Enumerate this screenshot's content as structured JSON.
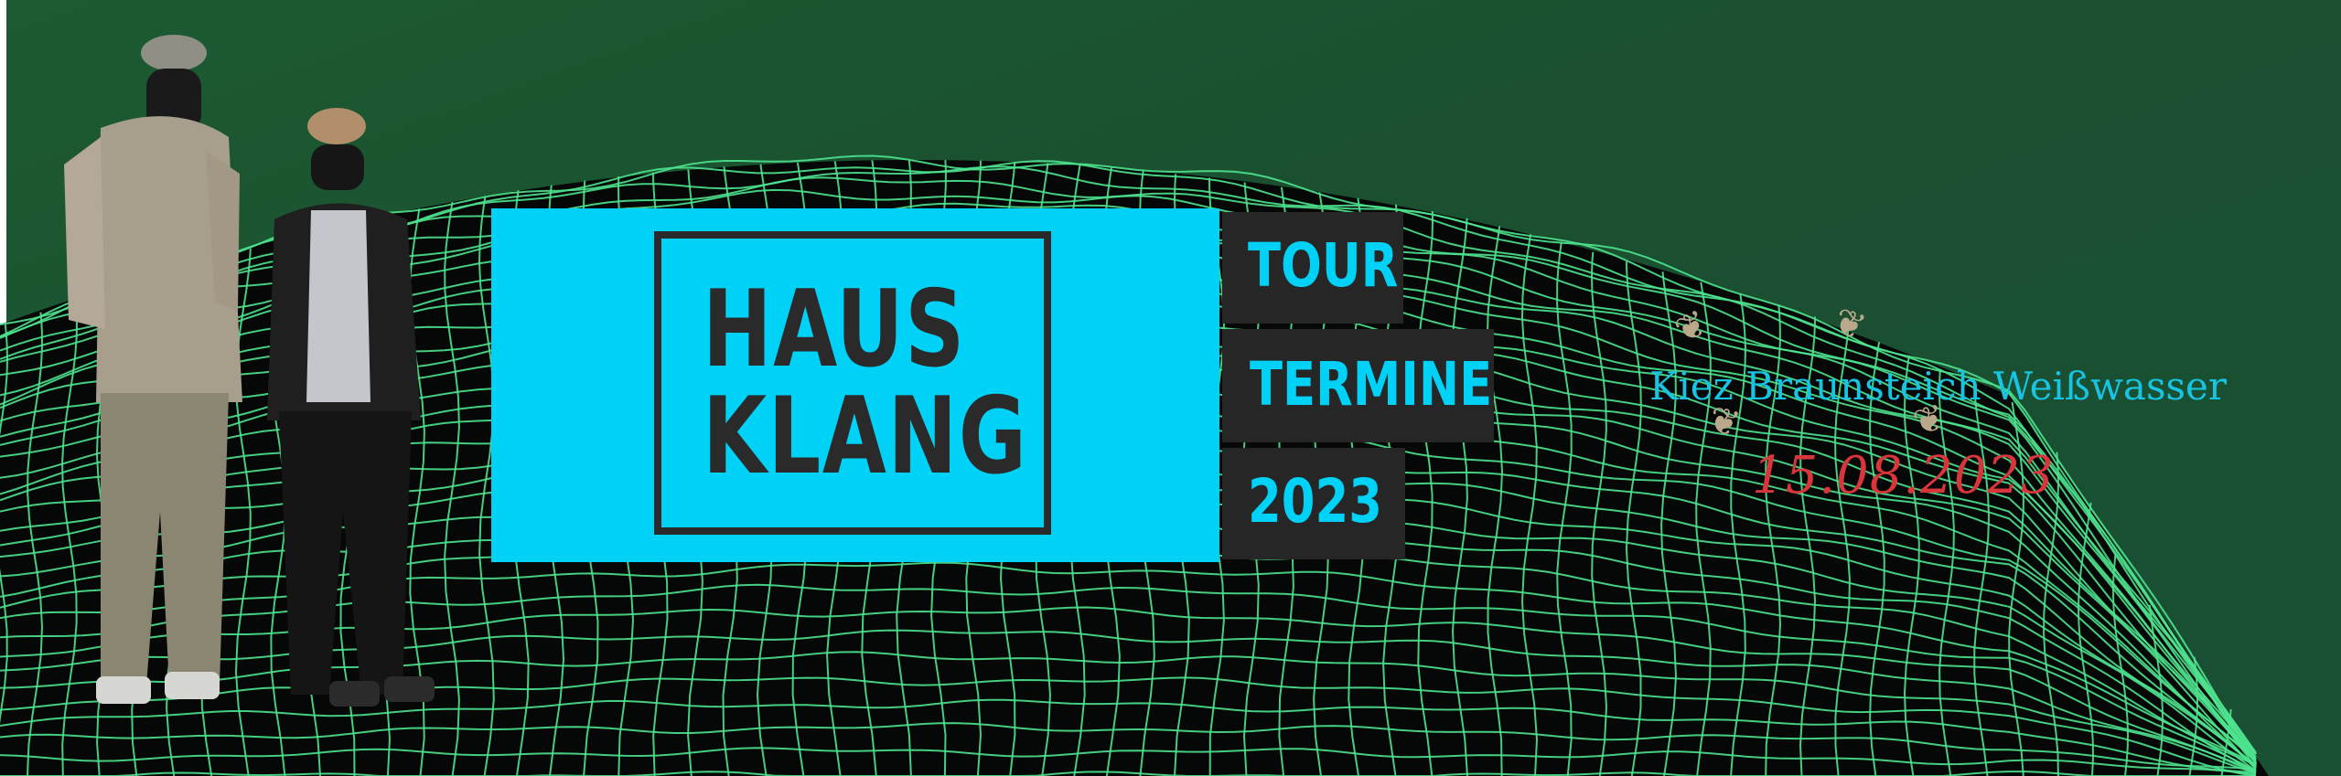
{
  "logo": {
    "line1": "HAUS",
    "line2": "KLANG"
  },
  "tags": {
    "tour": "TOUR",
    "termine": "TERMINE",
    "year": "2023"
  },
  "event": {
    "location": "Kiez Braunsteich Weißwasser",
    "date": "15.08.2023"
  },
  "colors": {
    "background": "#1a5030",
    "grid": "#4ee38e",
    "accent": "#00d2f7",
    "date": "#d8363b",
    "dark": "#262626"
  },
  "icons": [
    "leaf-ornament-icon"
  ]
}
